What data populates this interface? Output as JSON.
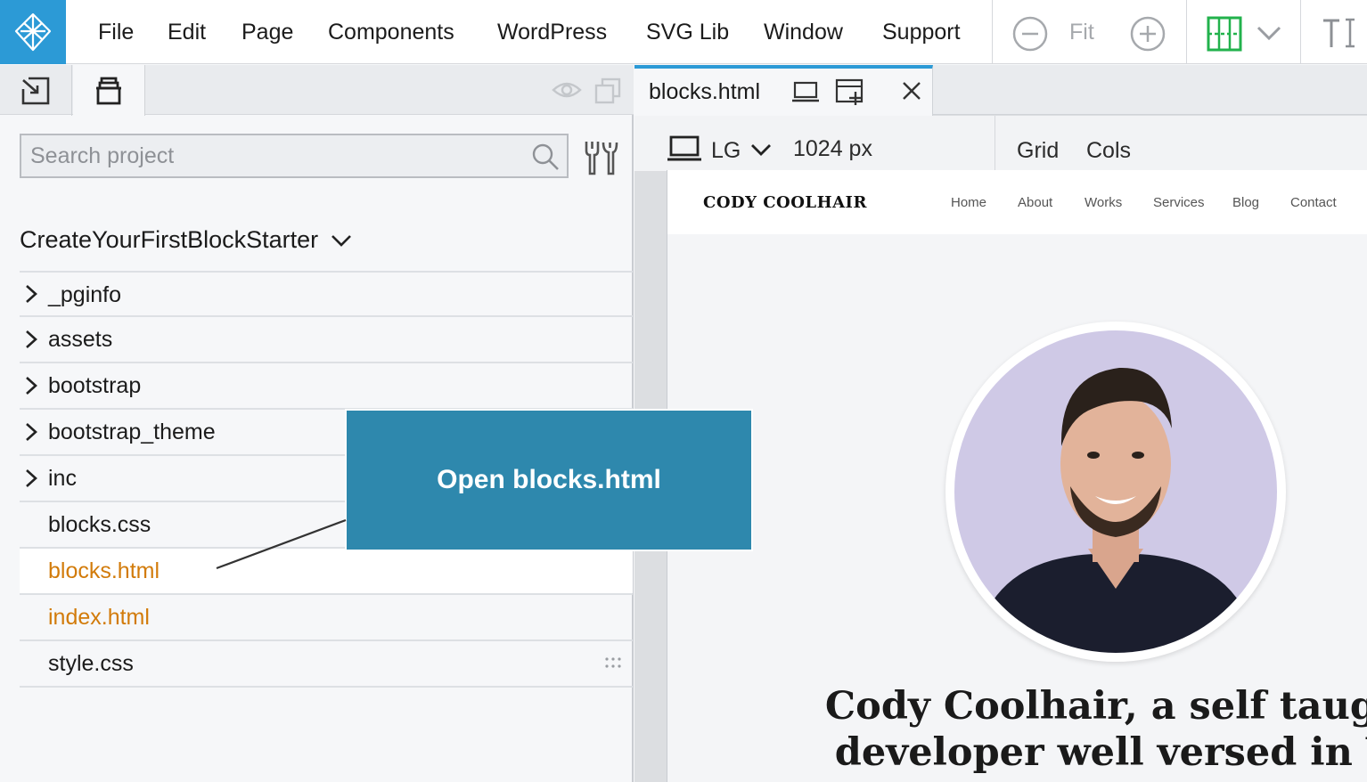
{
  "menubar": {
    "items": [
      "File",
      "Edit",
      "Page",
      "Components",
      "WordPress",
      "SVG Lib",
      "Window",
      "Support"
    ],
    "zoom_fit": "Fit"
  },
  "left_panel": {
    "search": {
      "placeholder": "Search project",
      "value": ""
    },
    "project_title": "CreateYourFirstBlockStarter",
    "tree": [
      {
        "label": "_pginfo",
        "type": "folder"
      },
      {
        "label": "assets",
        "type": "folder"
      },
      {
        "label": "bootstrap",
        "type": "folder"
      },
      {
        "label": "bootstrap_theme",
        "type": "folder"
      },
      {
        "label": "inc",
        "type": "folder"
      },
      {
        "label": "blocks.css",
        "type": "file"
      },
      {
        "label": "blocks.html",
        "type": "file",
        "highlight": true
      },
      {
        "label": "index.html",
        "type": "file",
        "highlight": true
      },
      {
        "label": "style.css",
        "type": "file"
      }
    ]
  },
  "callout": {
    "text": "Open blocks.html"
  },
  "editor": {
    "tab_label": "blocks.html",
    "breakpoint": "LG",
    "width": "1024 px",
    "grid_label": "Grid",
    "cols_label": "Cols"
  },
  "preview": {
    "brand": "CODY COOLHAIR",
    "nav": [
      "Home",
      "About",
      "Works",
      "Services",
      "Blog",
      "Contact"
    ],
    "hero_line1": "Cody Coolhair, a self taught w",
    "hero_line2": "developer well versed in Visu"
  },
  "colors": {
    "accent": "#2c9ad6",
    "callout": "#2e88ad",
    "highlight_file": "#d27b0a",
    "grid_toggle": "#22b24c"
  }
}
